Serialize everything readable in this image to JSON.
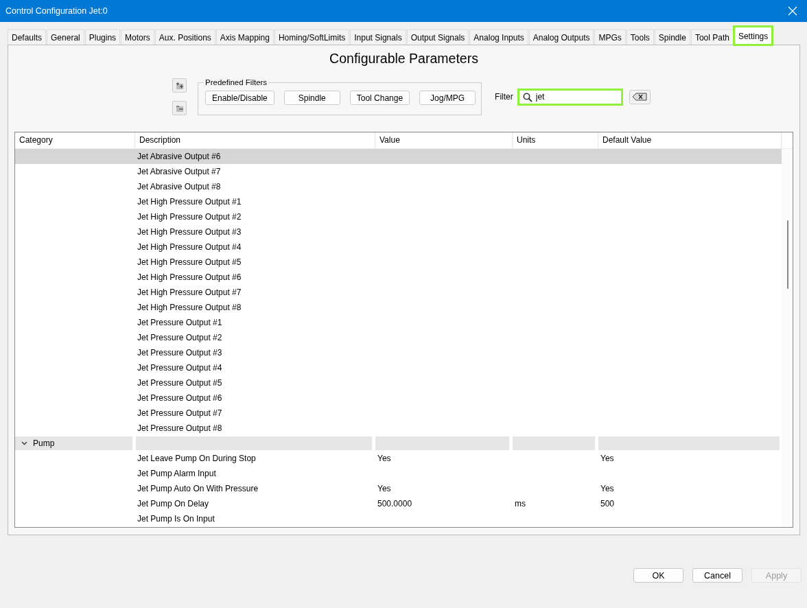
{
  "window": {
    "title": "Control Configuration Jet:0"
  },
  "tabs": [
    {
      "label": "Defaults",
      "selected": false,
      "highlighted": false
    },
    {
      "label": "General",
      "selected": false,
      "highlighted": false
    },
    {
      "label": "Plugins",
      "selected": false,
      "highlighted": false
    },
    {
      "label": "Motors",
      "selected": false,
      "highlighted": false
    },
    {
      "label": "Aux. Positions",
      "selected": false,
      "highlighted": false
    },
    {
      "label": "Axis Mapping",
      "selected": false,
      "highlighted": false
    },
    {
      "label": "Homing/SoftLimits",
      "selected": false,
      "highlighted": false
    },
    {
      "label": "Input Signals",
      "selected": false,
      "highlighted": false
    },
    {
      "label": "Output Signals",
      "selected": false,
      "highlighted": false
    },
    {
      "label": "Analog Inputs",
      "selected": false,
      "highlighted": false
    },
    {
      "label": "Analog Outputs",
      "selected": false,
      "highlighted": false
    },
    {
      "label": "MPGs",
      "selected": false,
      "highlighted": false
    },
    {
      "label": "Tools",
      "selected": false,
      "highlighted": false
    },
    {
      "label": "Spindle",
      "selected": false,
      "highlighted": false
    },
    {
      "label": "Tool Path",
      "selected": false,
      "highlighted": false
    },
    {
      "label": "Settings",
      "selected": true,
      "highlighted": true
    }
  ],
  "heading": "Configurable Parameters",
  "predefined_filters": {
    "title": "Predefined Filters",
    "buttons": [
      "Enable/Disable",
      "Spindle",
      "Tool Change",
      "Jog/MPG"
    ]
  },
  "filter": {
    "label": "Filter",
    "value": "jet",
    "highlighted": true
  },
  "table": {
    "columns": [
      "Category",
      "Description",
      "Value",
      "Units",
      "Default Value"
    ],
    "rows": [
      {
        "kind": "item",
        "selected": true,
        "description": "Jet Abrasive Output #6"
      },
      {
        "kind": "item",
        "selected": false,
        "description": "Jet Abrasive Output #7"
      },
      {
        "kind": "item",
        "selected": false,
        "description": "Jet Abrasive Output #8"
      },
      {
        "kind": "item",
        "selected": false,
        "description": "Jet High Pressure Output #1"
      },
      {
        "kind": "item",
        "selected": false,
        "description": "Jet High Pressure Output #2"
      },
      {
        "kind": "item",
        "selected": false,
        "description": "Jet High Pressure Output #3"
      },
      {
        "kind": "item",
        "selected": false,
        "description": "Jet High Pressure Output #4"
      },
      {
        "kind": "item",
        "selected": false,
        "description": "Jet High Pressure Output #5"
      },
      {
        "kind": "item",
        "selected": false,
        "description": "Jet High Pressure Output #6"
      },
      {
        "kind": "item",
        "selected": false,
        "description": "Jet High Pressure Output #7"
      },
      {
        "kind": "item",
        "selected": false,
        "description": "Jet High Pressure Output #8"
      },
      {
        "kind": "item",
        "selected": false,
        "description": "Jet Pressure Output #1"
      },
      {
        "kind": "item",
        "selected": false,
        "description": "Jet Pressure Output #2"
      },
      {
        "kind": "item",
        "selected": false,
        "description": "Jet Pressure Output #3"
      },
      {
        "kind": "item",
        "selected": false,
        "description": "Jet Pressure Output #4"
      },
      {
        "kind": "item",
        "selected": false,
        "description": "Jet Pressure Output #5"
      },
      {
        "kind": "item",
        "selected": false,
        "description": "Jet Pressure Output #6"
      },
      {
        "kind": "item",
        "selected": false,
        "description": "Jet Pressure Output #7"
      },
      {
        "kind": "item",
        "selected": false,
        "description": "Jet Pressure Output #8"
      },
      {
        "kind": "group",
        "selected": false,
        "expanded": true,
        "category": "Pump"
      },
      {
        "kind": "item",
        "selected": false,
        "description": "Jet Leave Pump On During Stop",
        "value": "Yes",
        "default": "Yes"
      },
      {
        "kind": "item",
        "selected": false,
        "description": "Jet Pump Alarm Input"
      },
      {
        "kind": "item",
        "selected": false,
        "description": "Jet Pump Auto On With Pressure",
        "value": "Yes",
        "default": "Yes"
      },
      {
        "kind": "item",
        "selected": false,
        "description": "Jet Pump On Delay",
        "value": "500.0000",
        "units": "ms",
        "default": "500"
      },
      {
        "kind": "item",
        "selected": false,
        "description": "Jet Pump Is On Input"
      }
    ]
  },
  "buttons": [
    {
      "label": "OK",
      "disabled": false
    },
    {
      "label": "Cancel",
      "disabled": false
    },
    {
      "label": "Apply",
      "disabled": true
    }
  ]
}
